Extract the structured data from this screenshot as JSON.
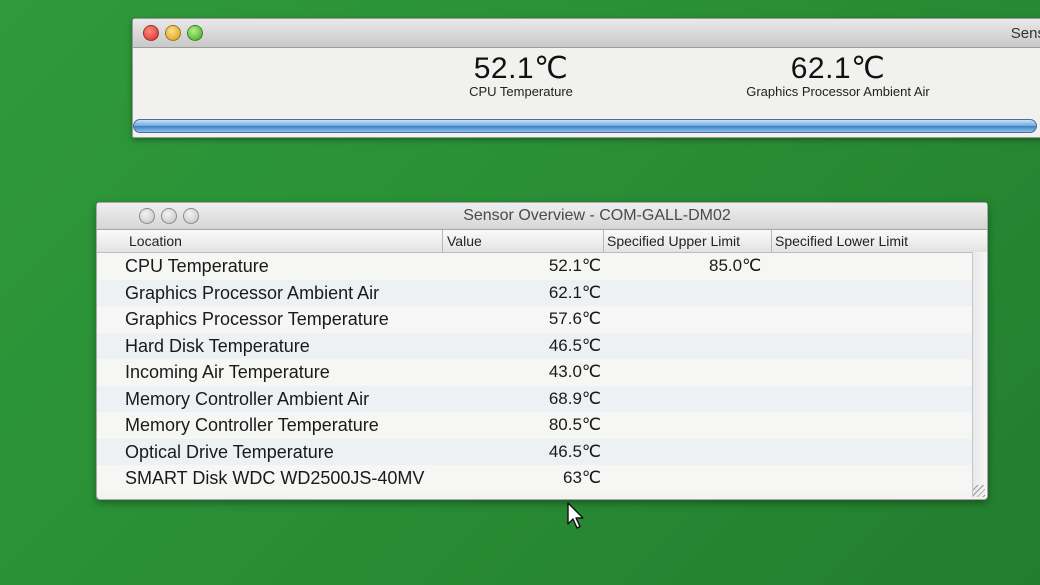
{
  "top_window": {
    "title": "Sens",
    "readings": [
      {
        "value": "52.1℃",
        "label": "CPU Temperature"
      },
      {
        "value": "62.1℃",
        "label": "Graphics Processor Ambient Air"
      }
    ]
  },
  "sensor_window": {
    "title": "Sensor Overview - COM-GALL-DM02",
    "columns": {
      "location": "Location",
      "value": "Value",
      "upper": "Specified Upper Limit",
      "lower": "Specified Lower Limit"
    },
    "rows": [
      {
        "location": "CPU Temperature",
        "value": "52.1℃",
        "upper": "85.0℃"
      },
      {
        "location": "Graphics Processor Ambient Air",
        "value": "62.1℃",
        "upper": ""
      },
      {
        "location": "Graphics Processor Temperature",
        "value": "57.6℃",
        "upper": ""
      },
      {
        "location": "Hard Disk Temperature",
        "value": "46.5℃",
        "upper": ""
      },
      {
        "location": "Incoming Air Temperature",
        "value": "43.0℃",
        "upper": ""
      },
      {
        "location": "Memory Controller Ambient Air",
        "value": "68.9℃",
        "upper": ""
      },
      {
        "location": "Memory Controller Temperature",
        "value": "80.5℃",
        "upper": ""
      },
      {
        "location": "Optical Drive Temperature",
        "value": "46.5℃",
        "upper": ""
      },
      {
        "location": "SMART Disk WDC WD2500JS-40MV",
        "value": "63℃",
        "upper": ""
      }
    ]
  },
  "icons": [
    "close-button",
    "minimize-button",
    "zoom-button",
    "mouse-pointer-icon",
    "resize-grip-icon"
  ]
}
